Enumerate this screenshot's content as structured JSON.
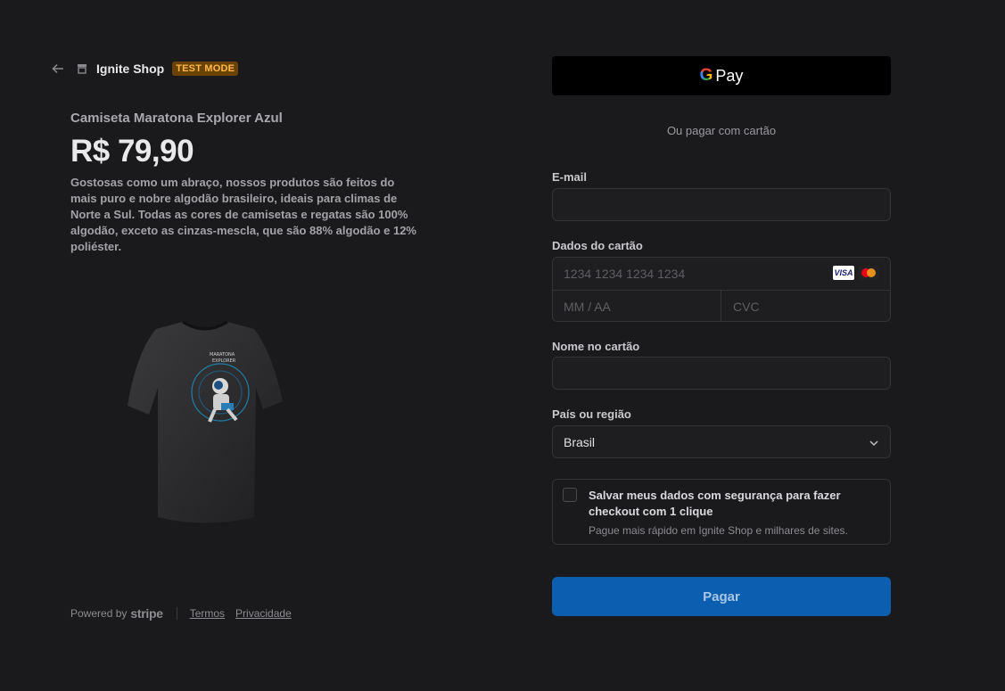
{
  "header": {
    "shop_name": "Ignite Shop",
    "badge": "TEST MODE"
  },
  "product": {
    "name": "Camiseta Maratona Explorer Azul",
    "price": "R$ 79,90",
    "description": "Gostosas como um abraço, nossos produtos são feitos do mais puro e nobre algodão brasileiro, ideais para climas de Norte a Sul. Todas as cores de camisetas e regatas são 100% algodão, exceto as cinzas-mescla, que são 88% algodão e 12% poliéster.",
    "image_icon": "t-shirt-image"
  },
  "footer": {
    "powered_by": "Powered by",
    "stripe": "stripe",
    "terms": "Termos",
    "privacy": "Privacidade"
  },
  "payment": {
    "gpay_g": "G",
    "gpay_label": "Pay",
    "or_text": "Ou pagar com cartão",
    "email_label": "E-mail",
    "email_value": "",
    "card_label": "Dados do cartão",
    "card_number_placeholder": "1234 1234 1234 1234",
    "card_expiry_placeholder": "MM / AA",
    "card_cvc_placeholder": "CVC",
    "visa": "VISA",
    "name_label": "Nome no cartão",
    "name_value": "",
    "country_label": "País ou região",
    "country_value": "Brasil",
    "save_title": "Salvar meus dados com segurança para fazer checkout com 1 clique",
    "save_subtitle": "Pague mais rápido em Ignite Shop e milhares de sites.",
    "pay_button": "Pagar"
  },
  "colors": {
    "background": "#1a1a1c",
    "pay_button": "#0c5fb0",
    "test_badge": "#6b4300"
  }
}
